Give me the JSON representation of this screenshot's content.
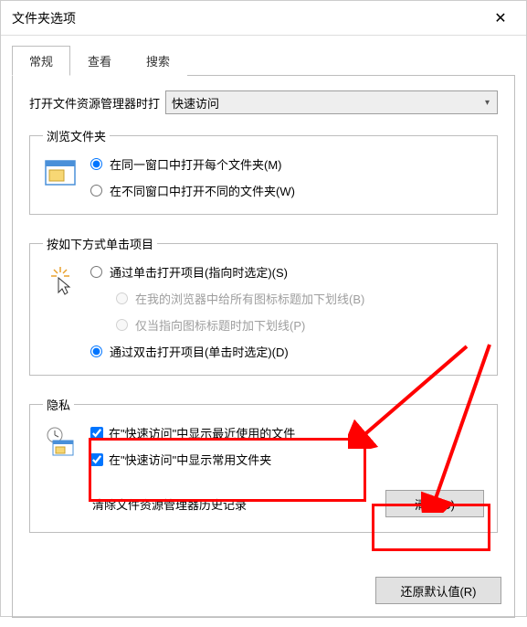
{
  "window": {
    "title": "文件夹选项"
  },
  "tabs": {
    "general": "常规",
    "view": "查看",
    "search": "搜索"
  },
  "openWith": {
    "label": "打开文件资源管理器时打",
    "value": "快速访问"
  },
  "browse": {
    "legend": "浏览文件夹",
    "opt1": "在同一窗口中打开每个文件夹(M)",
    "opt2": "在不同窗口中打开不同的文件夹(W)"
  },
  "click": {
    "legend": "按如下方式单击项目",
    "opt1": "通过单击打开项目(指向时选定)(S)",
    "sub1": "在我的浏览器中给所有图标标题加下划线(B)",
    "sub2": "仅当指向图标标题时加下划线(P)",
    "opt2": "通过双击打开项目(单击时选定)(D)"
  },
  "privacy": {
    "legend": "隐私",
    "chk1": "在\"快速访问\"中显示最近使用的文件",
    "chk2": "在\"快速访问\"中显示常用文件夹",
    "clearLabel": "清除文件资源管理器历史记录",
    "clearBtn": "清除(C)"
  },
  "restore": "还原默认值(R)",
  "close": "✕"
}
